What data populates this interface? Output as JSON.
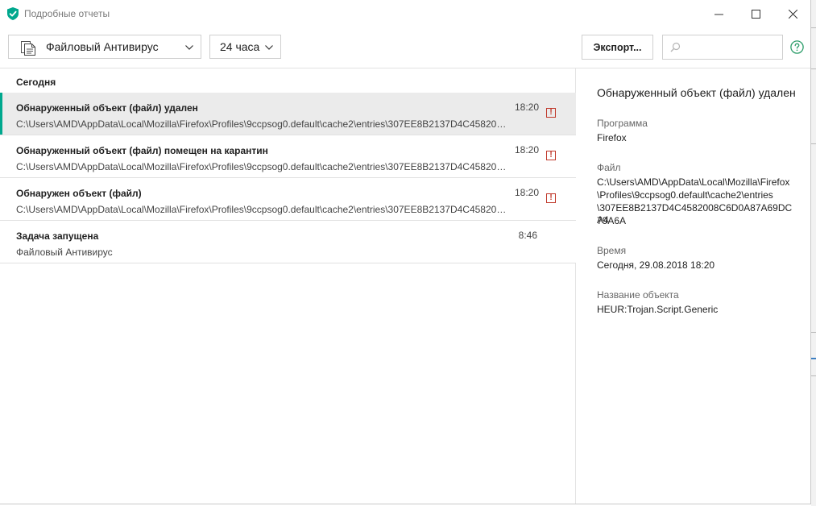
{
  "window": {
    "title": "Подробные отчеты"
  },
  "toolbar": {
    "component_dropdown": "Файловый Антивирус",
    "period_dropdown": "24 часа",
    "export_label": "Экспорт...",
    "search_value": "",
    "search_placeholder": ""
  },
  "list": {
    "group_header": "Сегодня",
    "rows": [
      {
        "title": "Обнаруженный объект (файл) удален",
        "subtitle": "C:\\Users\\AMD\\AppData\\Local\\Mozilla\\Firefox\\Profiles\\9ccpsog0.default\\cache2\\entries\\307EE8B2137D4C458200...",
        "time": "18:20",
        "alert": "!"
      },
      {
        "title": "Обнаруженный объект (файл) помещен на карантин",
        "subtitle": "C:\\Users\\AMD\\AppData\\Local\\Mozilla\\Firefox\\Profiles\\9ccpsog0.default\\cache2\\entries\\307EE8B2137D4C458200...",
        "time": "18:20",
        "alert": "!"
      },
      {
        "title": "Обнаружен объект (файл)",
        "subtitle": "C:\\Users\\AMD\\AppData\\Local\\Mozilla\\Firefox\\Profiles\\9ccpsog0.default\\cache2\\entries\\307EE8B2137D4C458200...",
        "time": "18:20",
        "alert": "!"
      },
      {
        "title": "Задача запущена",
        "subtitle": "Файловый Антивирус",
        "time": "8:46"
      }
    ]
  },
  "details": {
    "title": "Обнаруженный объект (файл) удален",
    "program_label": "Программа",
    "program_value": "Firefox",
    "file_label": "Файл",
    "file_line1": "C:\\Users\\AMD\\AppData\\Local\\Mozilla\\Firefox",
    "file_line2": "\\Profiles\\9ccpsog0.default\\cache2\\entries",
    "file_line3": "\\307EE8B2137D4C4582008C6D0A87A69DCA4",
    "file_line4": "79A6A",
    "time_label": "Время",
    "time_value": "Сегодня, 29.08.2018 18:20",
    "object_label": "Название объекта",
    "object_value": "HEUR:Trojan.Script.Generic"
  },
  "colors": {
    "accent": "#00a88e",
    "alert": "#c0392b",
    "selected_row": "#ebebeb"
  },
  "icons": {
    "app": "shield-icon",
    "component": "document-icon",
    "search": "search-icon",
    "help": "help-icon"
  }
}
